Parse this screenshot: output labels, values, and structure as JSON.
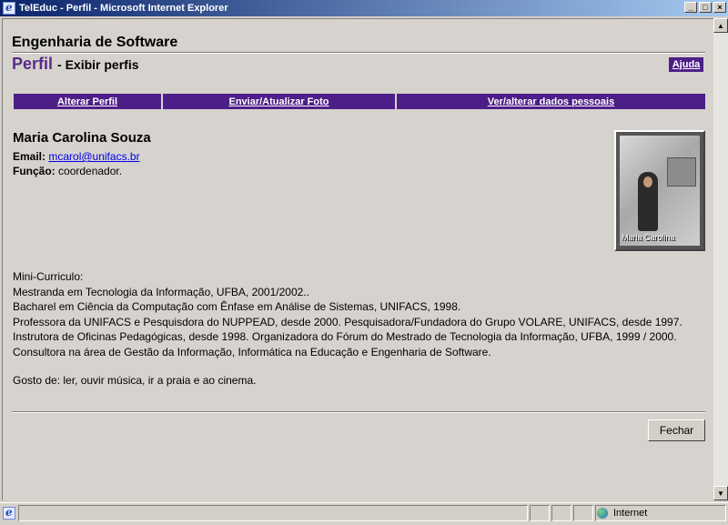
{
  "window": {
    "title": "TelEduc - Perfil - Microsoft Internet Explorer"
  },
  "header": {
    "course_title": "Engenharia de Software",
    "page_title": "Perfil",
    "page_subtitle": "- Exibir perfis",
    "help_label": "Ajuda"
  },
  "menu": {
    "items": [
      {
        "label": "Alterar Perfil"
      },
      {
        "label": "Enviar/Atualizar Foto"
      },
      {
        "label": "Ver/alterar dados pessoais"
      }
    ]
  },
  "profile": {
    "name": "Maria Carolina Souza",
    "email_label": "Email:",
    "email": "mcarol@unifacs.br",
    "role_label": "Função:",
    "role": "coordenador.",
    "photo_caption": "Maria Carolina"
  },
  "curriculum": {
    "heading": "Mini-Curriculo:",
    "lines": [
      "Mestranda em Tecnologia da Informação, UFBA, 2001/2002..",
      "Bacharel em Ciência da Computação com Ênfase em Análise de Sistemas, UNIFACS, 1998.",
      "Professora da UNIFACS e Pesquisdora do NUPPEAD, desde 2000. Pesquisadora/Fundadora do Grupo VOLARE, UNIFACS, desde 1997. Instrutora de Oficinas Pedagógicas, desde 1998. Organizadora do Fórum do Mestrado de Tecnologia da Informação, UFBA, 1999 / 2000. Consultora na área de Gestão da Informação, Informática na Educação e Engenharia de Software."
    ],
    "hobbies": "Gosto de: ler, ouvir música, ir a praia e ao cinema."
  },
  "actions": {
    "close_label": "Fechar"
  },
  "statusbar": {
    "zone": "Internet"
  }
}
